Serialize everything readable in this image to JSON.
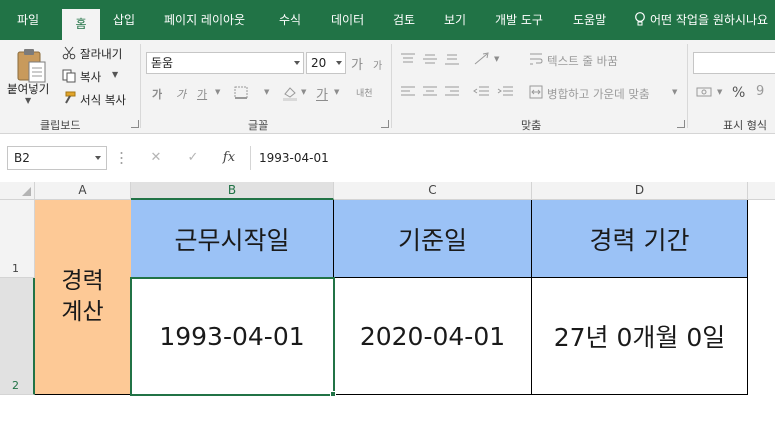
{
  "menu": {
    "tabs": [
      "파일",
      "홈",
      "삽입",
      "페이지 레이아웃",
      "수식",
      "데이터",
      "검토",
      "보기",
      "개발 도구",
      "도움말"
    ],
    "active_tab": "홈",
    "tell_me": "어떤 작업을 원하시나요"
  },
  "ribbon": {
    "clipboard": {
      "paste": "붙여넣기",
      "cut": "잘라내기",
      "copy": "복사",
      "format_painter": "서식 복사",
      "label": "클립보드"
    },
    "font": {
      "name": "돋움",
      "size": "20",
      "grow": "가",
      "shrink": "가",
      "bold": "가",
      "italic": "가",
      "underline": "가",
      "font_color": "가",
      "phonetic": "내천",
      "label": "글꼴"
    },
    "alignment": {
      "wrap_text": "텍스트 줄 바꿈",
      "merge_center": "병합하고 가운데 맞춤",
      "label": "맞춤"
    },
    "number": {
      "percent": "%",
      "label": "표시 형식"
    }
  },
  "formula_bar": {
    "name_box": "B2",
    "fx": "fx",
    "formula": "1993-04-01"
  },
  "sheet": {
    "columns": [
      "A",
      "B",
      "C",
      "D"
    ],
    "selected_column": "B",
    "rows": [
      "1",
      "2"
    ],
    "selected_row": "2",
    "cells": {
      "A1_A2": [
        "경력",
        "계산"
      ],
      "B1": "근무시작일",
      "C1": "기준일",
      "D1": "경력 기간",
      "B2": "1993-04-01",
      "C2": "2020-04-01",
      "D2": "27년 0개월 0일"
    },
    "colors": {
      "header_fill": "#9bc2f6",
      "label_fill": "#fdc996",
      "selection": "#217346"
    }
  }
}
